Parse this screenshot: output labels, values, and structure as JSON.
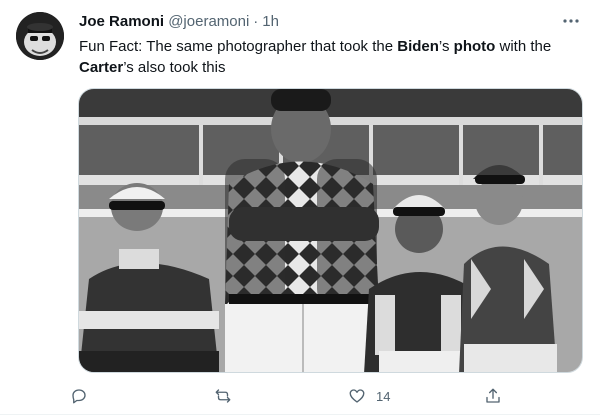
{
  "tweet": {
    "display_name": "Joe Ramoni",
    "handle": "@joeramoni",
    "separator": "·",
    "time": "1h",
    "text_parts": [
      {
        "t": "Fun Fact: The same photographer that took the ",
        "bold": false
      },
      {
        "t": "Biden",
        "bold": true
      },
      {
        "t": "’s ",
        "bold": false
      },
      {
        "t": "photo",
        "bold": true
      },
      {
        "t": " with the ",
        "bold": false
      },
      {
        "t": "Carter",
        "bold": true
      },
      {
        "t": "’s also took this",
        "bold": false
      }
    ],
    "media_icon": "photo-black-and-white-jockeys",
    "actions": {
      "reply": {
        "icon": "reply-icon",
        "count": ""
      },
      "retweet": {
        "icon": "retweet-icon",
        "count": ""
      },
      "like": {
        "icon": "heart-icon",
        "count": "14"
      },
      "share": {
        "icon": "share-icon",
        "count": ""
      }
    }
  },
  "colors": {
    "text": "#0f1419",
    "secondary": "#536471",
    "border": "#cfd9de"
  }
}
